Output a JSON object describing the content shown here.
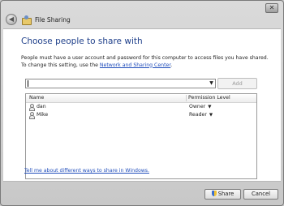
{
  "window": {
    "title": "File Sharing",
    "close_label": "✕"
  },
  "main": {
    "heading": "Choose people to share with",
    "description_text": "People must have a user account and password for this computer to access files you have shared. To change this setting, use the ",
    "description_link": "Network and Sharing Center",
    "description_end": ".",
    "combo_value": "",
    "add_label": "Add"
  },
  "table": {
    "headers": {
      "name": "Name",
      "permission": "Permission Level"
    },
    "rows": [
      {
        "name": "dan",
        "permission": "Owner"
      },
      {
        "name": "Mike",
        "permission": "Reader"
      }
    ]
  },
  "help_link": "Tell me about different ways to share in Windows.",
  "footer": {
    "share_label": "Share",
    "cancel_label": "Cancel"
  },
  "icons": {
    "back": "back-arrow-icon",
    "title": "file-sharing-icon",
    "user": "user-icon",
    "dropdown": "chevron-down-icon",
    "uac": "uac-shield-icon"
  }
}
